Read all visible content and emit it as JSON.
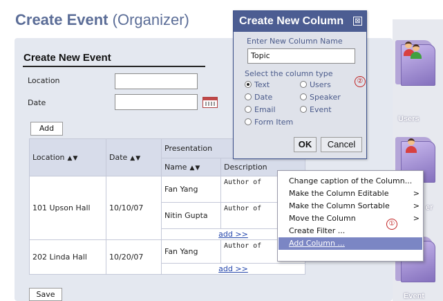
{
  "page": {
    "title_bold": "Create Event",
    "title_rest": " (Organizer)"
  },
  "form": {
    "heading": "Create New Event",
    "location_label": "Location",
    "date_label": "Date",
    "add_button": "Add",
    "save_button": "Save"
  },
  "table": {
    "headers": {
      "location": "Location",
      "date": "Date",
      "presentation": "Presentation",
      "name": "Name",
      "description": "Description"
    },
    "sort_glyph": "▲▼",
    "rows": [
      {
        "location": "101 Upson Hall",
        "date": "10/10/07",
        "presentations": [
          {
            "name": "Fan Yang",
            "description": "Author of"
          },
          {
            "name": "Nitin Gupta",
            "description": "Author of"
          }
        ],
        "add_link": "add >>"
      },
      {
        "location": "202 Linda Hall",
        "date": "10/20/07",
        "presentations": [
          {
            "name": "Fan Yang",
            "description": "Author of"
          }
        ],
        "add_link": "add >>"
      }
    ]
  },
  "dialog": {
    "title": "Create New Column",
    "close_glyph": "⊠",
    "name_label": "Enter New Column Name",
    "name_value": "Topic",
    "type_label": "Select the column type",
    "types": [
      "Text",
      "Users",
      "Date",
      "Speaker",
      "Email",
      "Event",
      "Form Item"
    ],
    "selected_type": "Text",
    "ok_button": "OK",
    "cancel_button": "Cancel",
    "step_marker": "②"
  },
  "context_menu": {
    "items": [
      {
        "label": "Change caption of the Column...",
        "submenu": false
      },
      {
        "label": "Make the Column Editable",
        "submenu": true
      },
      {
        "label": "Make the Column Sortable",
        "submenu": true
      },
      {
        "label": "Move the Column",
        "submenu": true
      },
      {
        "label": "Create Filter ...",
        "submenu": false
      },
      {
        "label": "Add Column ...",
        "submenu": false,
        "selected": true
      }
    ],
    "arrow_glyph": ">",
    "step_marker": "①"
  },
  "sidebar": {
    "items": [
      {
        "label": "Users",
        "icon": "users-folder-icon"
      },
      {
        "label": "er",
        "icon": "speaker-folder-icon"
      },
      {
        "label": "Event",
        "icon": "event-folder-icon"
      }
    ]
  },
  "colors": {
    "title": "#5b6d97",
    "dialog_bar": "#4c5d92",
    "menu_highlight": "#7b86c4",
    "marker": "#c02020"
  }
}
